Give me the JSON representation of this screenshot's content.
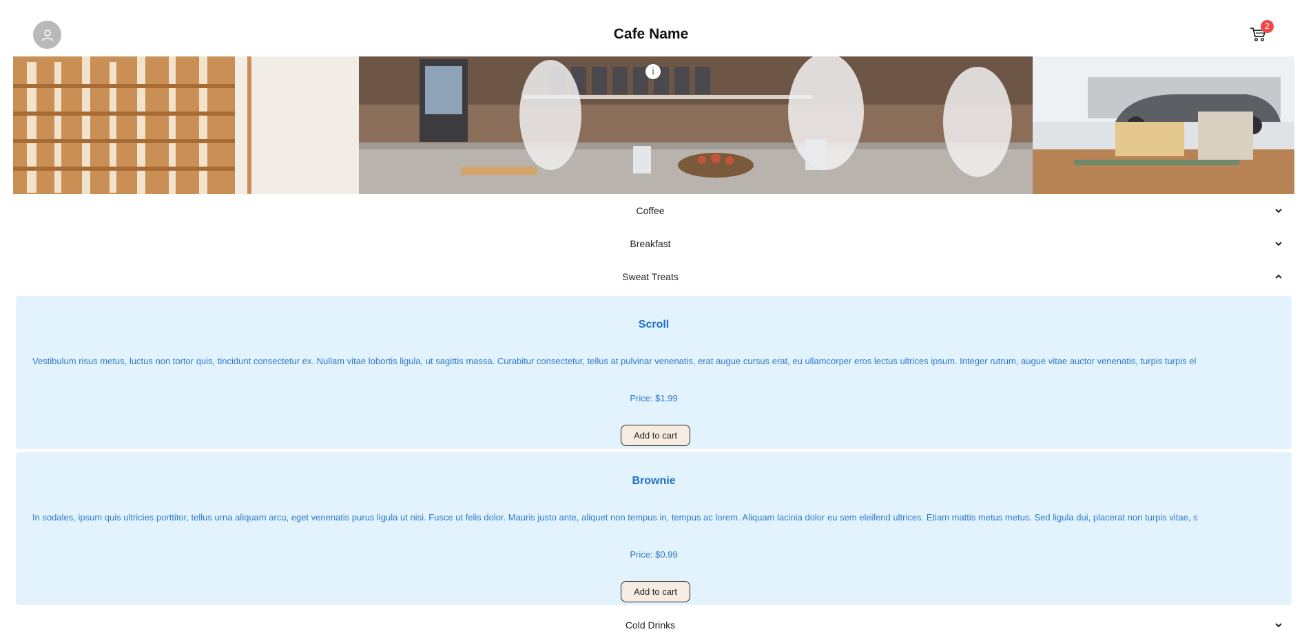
{
  "header": {
    "title": "Cafe Name",
    "cart_count": "2",
    "avatar_icon": "user-avatar-icon",
    "cart_icon": "shopping-cart-icon"
  },
  "banner": {
    "info_glyph": "i",
    "info_icon": "info-icon"
  },
  "categories": [
    {
      "label": "Coffee",
      "expanded": false
    },
    {
      "label": "Breakfast",
      "expanded": false
    },
    {
      "label": "Sweat Treats",
      "expanded": true
    },
    {
      "label": "Cold Drinks",
      "expanded": false
    }
  ],
  "items": [
    {
      "name": "Scroll",
      "description": "Vestibulum risus metus, luctus non tortor quis, tincidunt consectetur ex. Nullam vitae lobortis ligula, ut sagittis massa. Curabitur consectetur, tellus at pulvinar venenatis, erat augue cursus erat, eu ullamcorper eros lectus ultrices ipsum. Integer rutrum, augue vitae auctor venenatis, turpis turpis el",
      "price": "Price: $1.99",
      "button": "Add to cart"
    },
    {
      "name": "Brownie",
      "description": "In sodales, ipsum quis ultricies porttitor, tellus urna aliquam arcu, eget venenatis purus ligula ut nisi. Fusce ut felis dolor. Mauris justo ante, aliquet non tempus in, tempus ac lorem. Aliquam lacinia dolor eu sem eleifend ultrices. Etiam mattis metus metus. Sed ligula dui, placerat non turpis vitae, s",
      "price": "Price: $0.99",
      "button": "Add to cart"
    }
  ],
  "colors": {
    "card_background": "#e3f3fd",
    "accent_text": "#1f6cc7",
    "badge": "#f04848",
    "button_background": "#f7ece2"
  }
}
